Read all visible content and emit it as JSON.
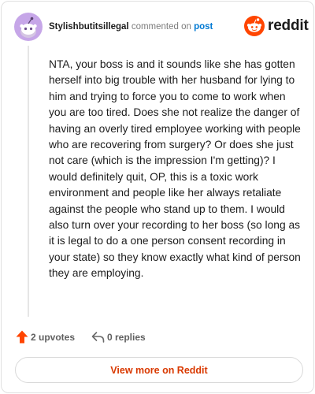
{
  "header": {
    "author": "Stylishbutitsillegal",
    "action_text": "commented on",
    "post_link": "post",
    "brand_name": "reddit"
  },
  "comment": {
    "body": "NTA, your boss is and it sounds like she has gotten herself into big trouble with her husband for lying to him and trying to force you to come to work when you are too tired. Does she not realize the danger of having an overly tired employee working with people who are recovering from surgery? Or does she just not care (which is the impression I'm getting)? I would definitely quit, OP, this is a toxic work environment and people like her always retaliate against the people who stand up to them. I would also turn over your recording to her boss (so long as it is legal to do a one person consent recording in your state) so they know exactly what kind of person they are employing."
  },
  "actions": {
    "upvotes_label": "2 upvotes",
    "replies_label": "0 replies"
  },
  "footer": {
    "view_more_label": "View more on Reddit"
  },
  "colors": {
    "brand_orange": "#ff4500",
    "avatar_purple": "#c6a6e8",
    "link_blue": "#0079d3",
    "view_more_text": "#d93900"
  },
  "icons": {
    "avatar": "snoo-avatar-icon",
    "brand": "reddit-logo-icon",
    "upvote": "upvote-arrow-icon",
    "reply": "reply-arrow-icon"
  }
}
